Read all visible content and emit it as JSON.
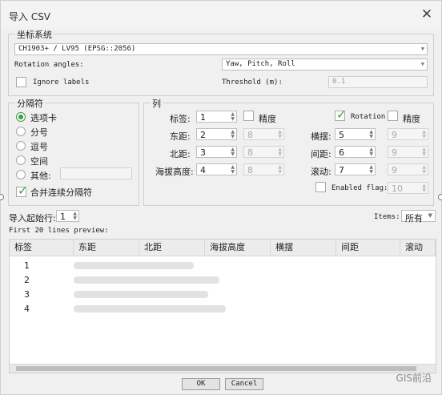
{
  "window": {
    "title": "导入 CSV",
    "close_glyph": "✕"
  },
  "crs": {
    "group_label": "坐标系统",
    "value": "CH1903+ / LV95 (EPSG::2056)",
    "rotation_label": "Rotation angles:",
    "rotation_value": "Yaw, Pitch, Roll",
    "ignore_labels": "Ignore labels",
    "threshold_label": "Threshold (m):",
    "threshold_value": "0.1"
  },
  "separator": {
    "group_label": "分隔符",
    "options": [
      "选项卡",
      "分号",
      "逗号",
      "空间",
      "其他:"
    ],
    "merge_label": "合并连续分隔符"
  },
  "columns": {
    "group_label": "列",
    "label": {
      "name": "标签:",
      "value": "1"
    },
    "precision_label": "精度",
    "default_precision": "8",
    "east": {
      "name": "东距:",
      "value": "2"
    },
    "north": {
      "name": "北距:",
      "value": "3"
    },
    "alt": {
      "name": "海拔高度:",
      "value": "4"
    },
    "rotation_label": "Rotation",
    "rotation_precision_label": "精度",
    "default_rotation_precision": "9",
    "yaw": {
      "name": "横摆:",
      "value": "5"
    },
    "pitch": {
      "name": "间距:",
      "value": "6"
    },
    "roll": {
      "name": "滚动:",
      "value": "7"
    },
    "enabled_flag_label": "Enabled flag:",
    "enabled_flag_value": "10"
  },
  "import": {
    "start_row_label": "导入起始行:",
    "start_row_value": "1",
    "items_label": "Items:",
    "items_value": "所有",
    "preview_label": "First 20 lines preview:"
  },
  "table": {
    "headers": [
      "标签",
      "东距",
      "北距",
      "海拔高度",
      "横摆",
      "间距",
      "滚动"
    ],
    "rows": [
      "1",
      "2",
      "3",
      "4"
    ]
  },
  "buttons": {
    "ok": "OK",
    "cancel": "Cancel"
  },
  "watermark": "GIS前沿"
}
